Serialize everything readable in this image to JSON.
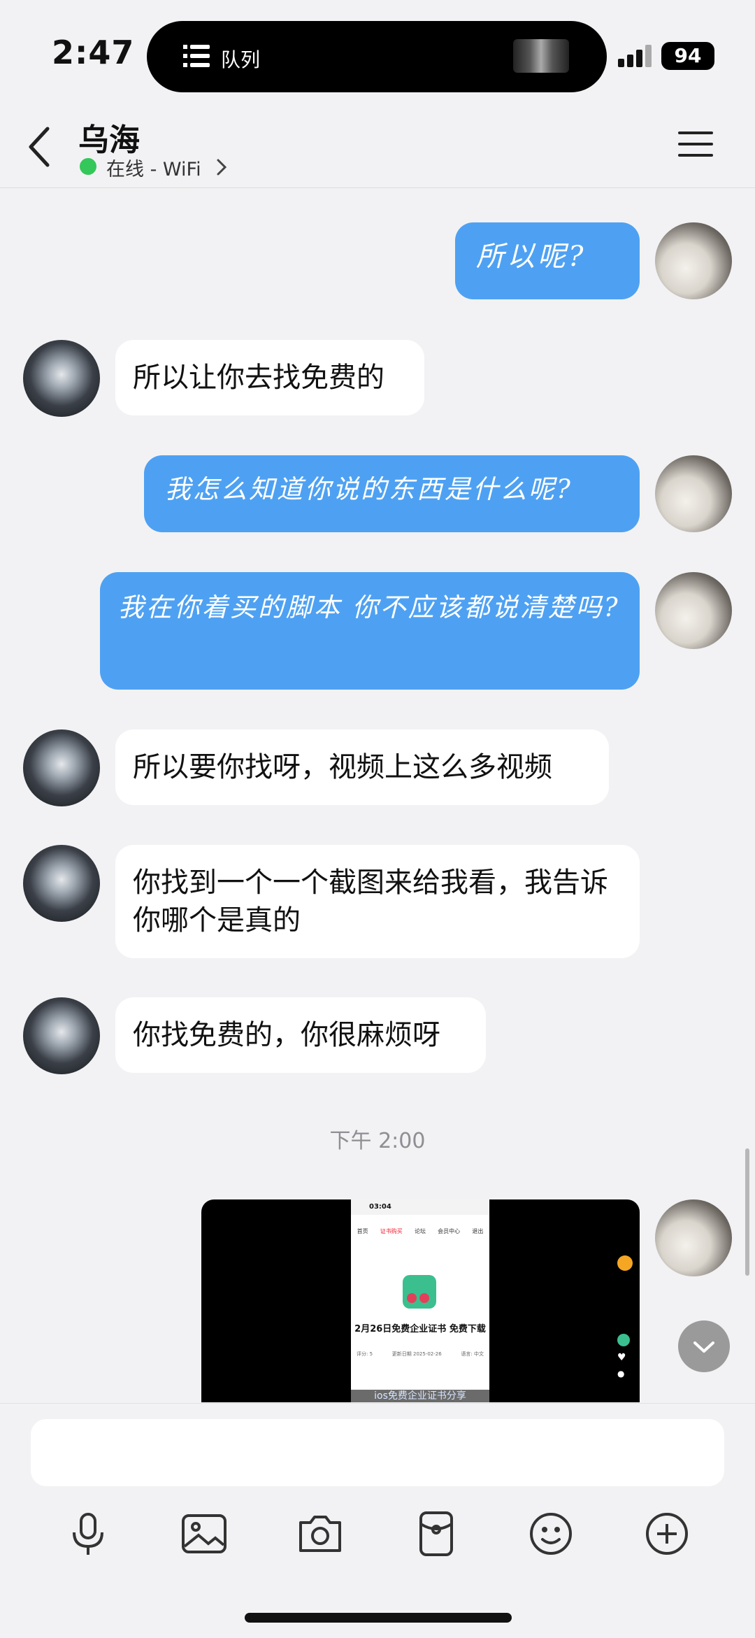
{
  "status_bar": {
    "time": "2:47",
    "island_label": "队列",
    "battery": "94"
  },
  "header": {
    "name": "乌海",
    "status": "在线 - WiFi"
  },
  "messages": [
    {
      "side": "self",
      "text": "所以呢?"
    },
    {
      "side": "other",
      "text": "所以让你去找免费的"
    },
    {
      "side": "self",
      "text": "我怎么知道你说的东西是什么呢?"
    },
    {
      "side": "self",
      "text": "我在你着买的脚本 你不应该都说清楚吗?"
    },
    {
      "side": "other",
      "text": "所以要你找呀，视频上这么多视频"
    },
    {
      "side": "other",
      "text": "你找到一个一个截图来给我看，我告诉你哪个是真的"
    },
    {
      "side": "other",
      "text": "你找免费的，你很麻烦呀"
    }
  ],
  "timestamp": "下午 2:00",
  "screenshot": {
    "time": "03:04",
    "nav": [
      "首页",
      "证书购买",
      "论坛",
      "会员中心",
      "退出"
    ],
    "title": "2月26日免费企业证书 免费下载",
    "meta": [
      "评分: 5",
      "更新日期 2025-02-26",
      "语言: 中文"
    ],
    "caption": "ios免费企业证书分享"
  },
  "toolbar": [
    "microphone",
    "image",
    "camera",
    "red-packet",
    "emoji",
    "plus"
  ]
}
